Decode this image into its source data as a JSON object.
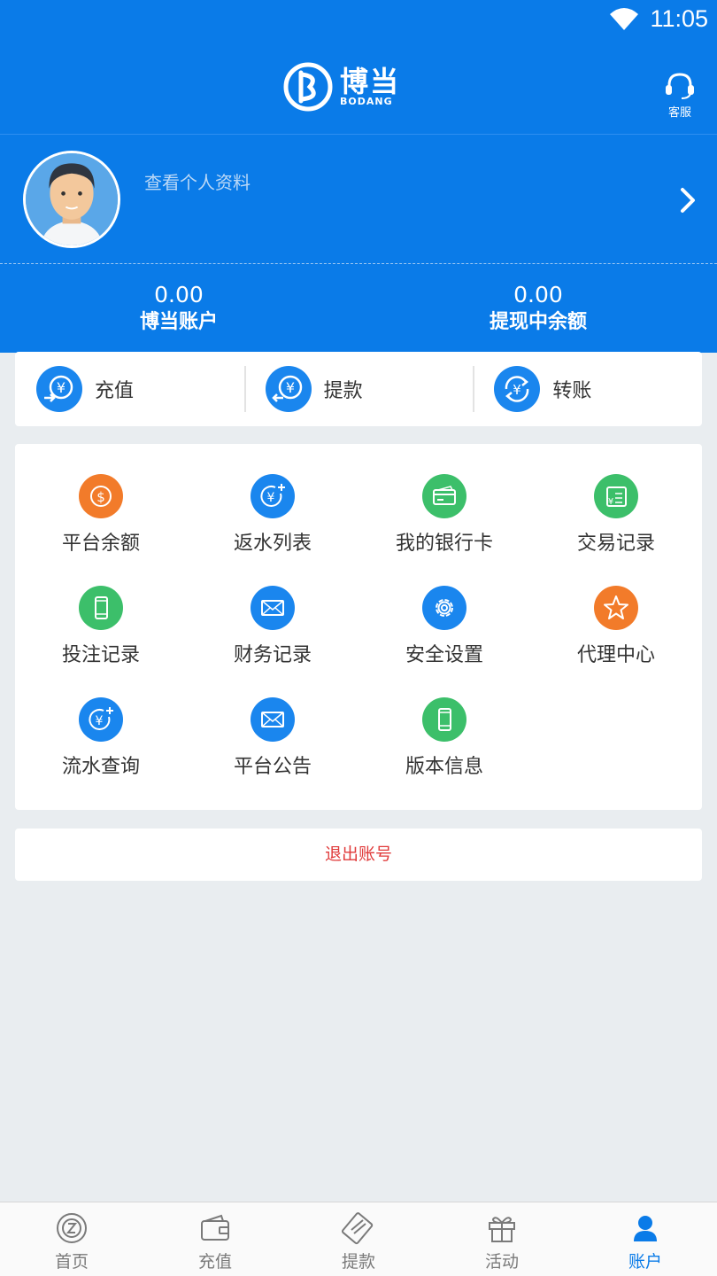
{
  "status_bar": {
    "time": "11:05"
  },
  "header": {
    "logo_cn": "博当",
    "logo_en": "BODANG",
    "service_label": "客服"
  },
  "profile": {
    "view_profile": "查看个人资料",
    "account_amount": "0.00",
    "account_label": "博当账户",
    "withdrawing_amount": "0.00",
    "withdrawing_label": "提现中余额"
  },
  "quick_actions": [
    {
      "label": "充值",
      "icon": "recharge-icon"
    },
    {
      "label": "提款",
      "icon": "withdraw-icon"
    },
    {
      "label": "转账",
      "icon": "transfer-icon"
    }
  ],
  "menu": [
    {
      "label": "平台余额",
      "icon": "coin-icon",
      "color": "#f27b2a"
    },
    {
      "label": "返水列表",
      "icon": "yuan-plus-icon",
      "color": "#1a86ee"
    },
    {
      "label": "我的银行卡",
      "icon": "bank-card-icon",
      "color": "#3cbf6a"
    },
    {
      "label": "交易记录",
      "icon": "receipt-icon",
      "color": "#3cbf6a"
    },
    {
      "label": "投注记录",
      "icon": "phone-icon",
      "color": "#3cbf6a"
    },
    {
      "label": "财务记录",
      "icon": "mail-icon",
      "color": "#1a86ee"
    },
    {
      "label": "安全设置",
      "icon": "gear-icon",
      "color": "#1a86ee"
    },
    {
      "label": "代理中心",
      "icon": "star-icon",
      "color": "#f27b2a"
    },
    {
      "label": "流水查询",
      "icon": "yuan-plus-icon",
      "color": "#1a86ee"
    },
    {
      "label": "平台公告",
      "icon": "mail-icon",
      "color": "#1a86ee"
    },
    {
      "label": "版本信息",
      "icon": "phone-icon",
      "color": "#3cbf6a"
    }
  ],
  "logout_label": "退出账号",
  "tabs": [
    {
      "label": "首页",
      "icon": "home-chip-icon"
    },
    {
      "label": "充值",
      "icon": "wallet-icon"
    },
    {
      "label": "提款",
      "icon": "card-icon"
    },
    {
      "label": "活动",
      "icon": "gift-icon"
    },
    {
      "label": "账户",
      "icon": "user-icon",
      "active": true
    }
  ],
  "colors": {
    "primary": "#0a7be8",
    "logout": "#e03a3a",
    "background": "#e9edf0"
  }
}
